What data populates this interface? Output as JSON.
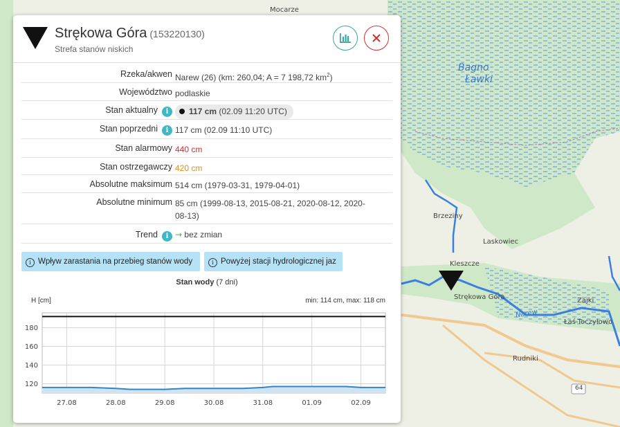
{
  "map": {
    "labels": {
      "mocarze": "Mocarze",
      "bagno": "Bagno",
      "lawki": "Ławki",
      "brzeziny": "Brzeziny",
      "laskowiec": "Laskowiec",
      "kleszcze": "Kleszcze",
      "strekowa_gora": "Strękowa Góra",
      "zajki": "Zajki",
      "las_toczylowo": "Łaś-Toczyłowo",
      "rudniki": "Rudniki",
      "road_64": "64",
      "narew": "Narew"
    },
    "colors": {
      "land": "#eef0e6",
      "forest": "#cfe8c8",
      "water": "#3a7ee0",
      "road": "#f0c890"
    }
  },
  "panel": {
    "station_icon": "down-triangle-icon",
    "title": "Strękowa Góra",
    "code": "(153220130)",
    "subtitle": "Strefa stanów niskich",
    "chart_button_icon": "bar-chart-icon",
    "close_button_icon": "close-icon",
    "rows": [
      {
        "label": "Rzeka/akwen",
        "value": "Narew (26) (km: 260,04; A = 7 198,72 km",
        "sup": "2",
        "value_end": ")"
      },
      {
        "label": "Województwo",
        "value": "podlaskie"
      },
      {
        "label": "Stan aktualny",
        "info": "i",
        "value_bold": "117 cm",
        "value": "(02.09 11:20 UTC)"
      },
      {
        "label": "Stan poprzedni",
        "info": "i",
        "value": "117 cm (02.09 11:10 UTC)"
      },
      {
        "label": "Stan alarmowy",
        "value": "440 cm",
        "color": "#e0291f"
      },
      {
        "label": "Stan ostrzegawczy",
        "value": "420 cm",
        "color": "#f08c00"
      },
      {
        "label": "Absolutne maksimum",
        "value": "514 cm (1979-03-31, 1979-04-01)"
      },
      {
        "label": "Absolutne minimum",
        "value": "85 cm (1999-08-13, 2015-08-21, 2020-08-12, 2020-08-13)"
      },
      {
        "label": "Trend",
        "info": "i",
        "trend_arrow": "→",
        "value": "bez zmian"
      }
    ],
    "tags": [
      {
        "icon": "info-icon",
        "text": "Wpływ zarastania na przebieg stanów wody"
      },
      {
        "icon": "info-icon",
        "text": "Powyżej stacji hydrologicznej jaz"
      }
    ],
    "chart_heading_bold": "Stan wody",
    "chart_heading_rest": "(7 dni)",
    "chart_ylabel": "H [cm]",
    "chart_minmax": "min: 114 cm, max: 118 cm"
  },
  "chart_data": {
    "type": "line",
    "title": "Stan wody (7 dni)",
    "ylabel": "H [cm]",
    "ylim": [
      110,
      196
    ],
    "yticks": [
      120,
      140,
      160,
      180
    ],
    "categories": [
      "27.08",
      "28.08",
      "29.08",
      "30.08",
      "31.08",
      "01.09",
      "02.09"
    ],
    "x_range": [
      26.5,
      33.5
    ],
    "reference_line": 192,
    "series": [
      {
        "values": [
          [
            26.5,
            116
          ],
          [
            27.5,
            116
          ],
          [
            28.0,
            115
          ],
          [
            28.3,
            114
          ],
          [
            29.0,
            114
          ],
          [
            29.4,
            115
          ],
          [
            30.0,
            115
          ],
          [
            30.6,
            115
          ],
          [
            31.0,
            116
          ],
          [
            31.2,
            117
          ],
          [
            32.0,
            117
          ],
          [
            32.7,
            117
          ],
          [
            33.0,
            116
          ],
          [
            33.5,
            116
          ]
        ]
      }
    ],
    "grid": true,
    "colors": {
      "line": "#2f87c9",
      "fill": "#cfe3f3",
      "reference": "#111111"
    }
  }
}
